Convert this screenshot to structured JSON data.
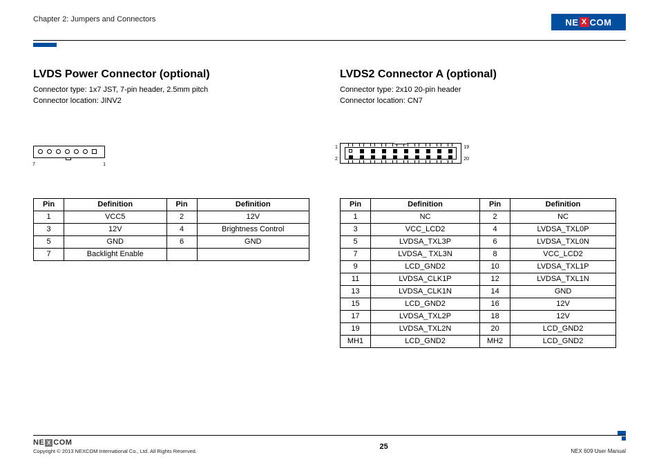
{
  "header": {
    "chapter": "Chapter 2: Jumpers and Connectors",
    "brand": {
      "pre": "NE",
      "x": "X",
      "post": "COM"
    }
  },
  "left": {
    "title": "LVDS Power Connector (optional)",
    "sub1": "Connector type: 1x7 JST, 7-pin header, 2.5mm pitch",
    "sub2": "Connector location: JINV2",
    "diagram": {
      "label7": "7",
      "label1": "1"
    },
    "table": {
      "headers": {
        "pin": "Pin",
        "def": "Definition"
      },
      "rows": [
        {
          "p1": "1",
          "d1": "VCC5",
          "p2": "2",
          "d2": "12V"
        },
        {
          "p1": "3",
          "d1": "12V",
          "p2": "4",
          "d2": "Brightness Control"
        },
        {
          "p1": "5",
          "d1": "GND",
          "p2": "6",
          "d2": "GND"
        },
        {
          "p1": "7",
          "d1": "Backlight Enable",
          "p2": "",
          "d2": ""
        }
      ]
    }
  },
  "right": {
    "title": "LVDS2 Connector A (optional)",
    "sub1": "Connector type: 2x10 20-pin header",
    "sub2": "Connector location: CN7",
    "diagram": {
      "l1": "1",
      "l2": "2",
      "l19": "19",
      "l20": "20"
    },
    "table": {
      "headers": {
        "pin": "Pin",
        "def": "Definition"
      },
      "rows": [
        {
          "p1": "1",
          "d1": "NC",
          "p2": "2",
          "d2": "NC"
        },
        {
          "p1": "3",
          "d1": "VCC_LCD2",
          "p2": "4",
          "d2": "LVDSA_TXL0P"
        },
        {
          "p1": "5",
          "d1": "LVDSA_TXL3P",
          "p2": "6",
          "d2": "LVDSA_TXL0N"
        },
        {
          "p1": "7",
          "d1": "LVDSA_ TXL3N",
          "p2": "8",
          "d2": "VCC_LCD2"
        },
        {
          "p1": "9",
          "d1": "LCD_GND2",
          "p2": "10",
          "d2": "LVDSA_TXL1P"
        },
        {
          "p1": "11",
          "d1": "LVDSA_CLK1P",
          "p2": "12",
          "d2": "LVDSA_TXL1N"
        },
        {
          "p1": "13",
          "d1": "LVDSA_CLK1N",
          "p2": "14",
          "d2": "GND"
        },
        {
          "p1": "15",
          "d1": "LCD_GND2",
          "p2": "16",
          "d2": "12V"
        },
        {
          "p1": "17",
          "d1": "LVDSA_TXL2P",
          "p2": "18",
          "d2": "12V"
        },
        {
          "p1": "19",
          "d1": "LVDSA_TXL2N",
          "p2": "20",
          "d2": "LCD_GND2"
        },
        {
          "p1": "MH1",
          "d1": "LCD_GND2",
          "p2": "MH2",
          "d2": "LCD_GND2"
        }
      ]
    }
  },
  "footer": {
    "brand": {
      "pre": "NE",
      "x": "X",
      "post": "COM"
    },
    "copyright": "Copyright © 2013 NEXCOM International Co., Ltd. All Rights Reserved.",
    "page": "25",
    "manual": "NEX 609 User Manual"
  }
}
